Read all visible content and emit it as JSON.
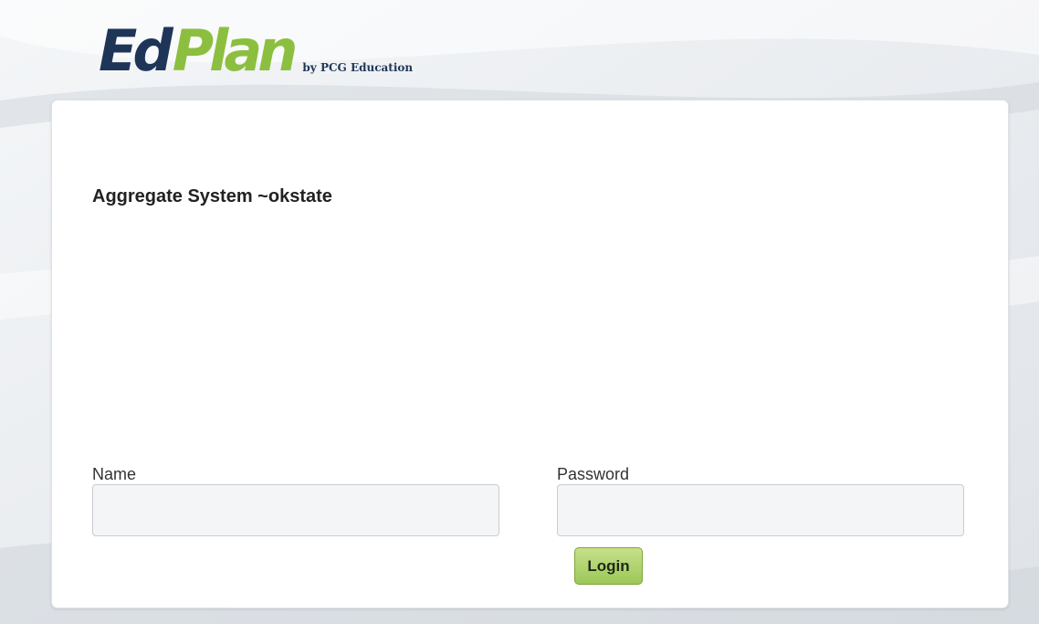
{
  "logo": {
    "ed": "Ed",
    "plan": "Plan",
    "byline": "by PCG Education"
  },
  "system_title": "Aggregate System ~okstate",
  "form": {
    "name_label": "Name",
    "name_value": "",
    "password_label": "Password",
    "password_value": "",
    "login_label": "Login"
  },
  "colors": {
    "logo_dark": "#1f3558",
    "logo_green": "#8cbf3f",
    "button_green": "#b4d474"
  }
}
